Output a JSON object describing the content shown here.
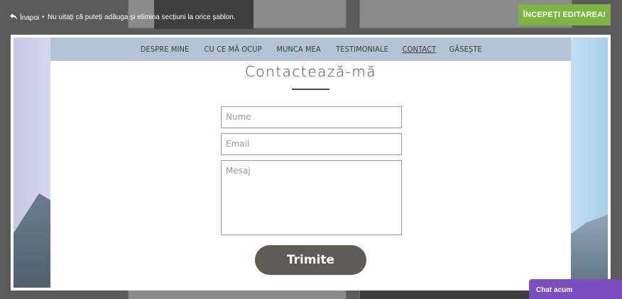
{
  "topbar": {
    "back_label": "Înapoi",
    "separator": "•",
    "hint": "Nu uitați că puteți adăuga și elimina secțiuni la orice șablon.",
    "start_label": "ÎNCEPEȚI EDITAREA!"
  },
  "nav": {
    "items": [
      "DESPRE MINE",
      "CU CE MĂ OCUP",
      "MUNCA MEA",
      "TESTIMONIALE",
      "CONTACT",
      "GĂSEȘTE"
    ]
  },
  "contact": {
    "title": "Contactează-mă",
    "name_placeholder": "Nume",
    "email_placeholder": "Email",
    "message_placeholder": "Mesaj",
    "submit_label": "Trimite"
  },
  "chat": {
    "label": "Chat acum"
  },
  "colors": {
    "accent_green": "#7cb342",
    "nav_bg": "#b3c4d4",
    "submit_bg": "#5e5a55",
    "chat_bg": "#7c4dbd"
  },
  "icons": {
    "back": "reply-arrow-icon"
  }
}
